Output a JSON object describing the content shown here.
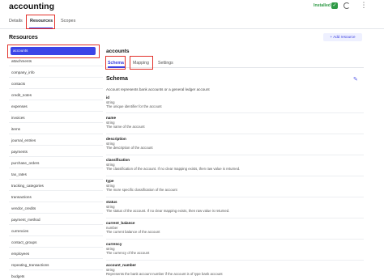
{
  "header": {
    "app_title": "accounting",
    "status_label": "Installed",
    "status_icon": "check-icon",
    "refresh_icon": "refresh-icon",
    "more_icon": "more-icon"
  },
  "tabs": [
    {
      "label": "Details"
    },
    {
      "label": "Resources"
    },
    {
      "label": "Scopes"
    }
  ],
  "sidebar": {
    "title": "Resources",
    "items": [
      {
        "label": "accounts"
      },
      {
        "label": "attachments"
      },
      {
        "label": "company_info"
      },
      {
        "label": "contacts"
      },
      {
        "label": "credit_notes"
      },
      {
        "label": "expenses"
      },
      {
        "label": "invoices"
      },
      {
        "label": "items"
      },
      {
        "label": "journal_entries"
      },
      {
        "label": "payments"
      },
      {
        "label": "purchase_orders"
      },
      {
        "label": "tax_rates"
      },
      {
        "label": "tracking_categories"
      },
      {
        "label": "transactions"
      },
      {
        "label": "vendor_credits"
      },
      {
        "label": "payment_method"
      },
      {
        "label": "currencies"
      },
      {
        "label": "contact_groups"
      },
      {
        "label": "employees"
      },
      {
        "label": "repeating_transactions"
      },
      {
        "label": "budgets"
      }
    ]
  },
  "add_button": {
    "label": "+ Add resource"
  },
  "detail": {
    "title": "accounts",
    "subtabs": [
      {
        "label": "Schema"
      },
      {
        "label": "Mapping"
      },
      {
        "label": "Settings"
      }
    ],
    "schema_heading": "Schema",
    "schema_description": "Account represents bank accounts or a general ledger account",
    "fields": [
      {
        "name": "id",
        "type": "string",
        "description": "The unique identifier for the account"
      },
      {
        "name": "name",
        "type": "string",
        "description": "The name of the account"
      },
      {
        "name": "description",
        "type": "string",
        "description": "The description of the account"
      },
      {
        "name": "classification",
        "type": "string",
        "description": "The classification of the account. If no clear mapping exists, then raw value is returned."
      },
      {
        "name": "type",
        "type": "string",
        "description": "The more specific classification of the account"
      },
      {
        "name": "status",
        "type": "string",
        "description": "The status of the account. If no clear mapping exists, then raw value is returned."
      },
      {
        "name": "current_balance",
        "type": "number",
        "description": "The current balance of the account"
      },
      {
        "name": "currency",
        "type": "string",
        "description": "The currency of the account"
      },
      {
        "name": "account_number",
        "type": "string",
        "description": "Represents the bank account number if the account is of type bank account"
      }
    ]
  },
  "colors": {
    "accent": "#3b3fe0",
    "selected": "#3c45e7",
    "highlight": "#e2312a",
    "success": "#2e9a45"
  }
}
